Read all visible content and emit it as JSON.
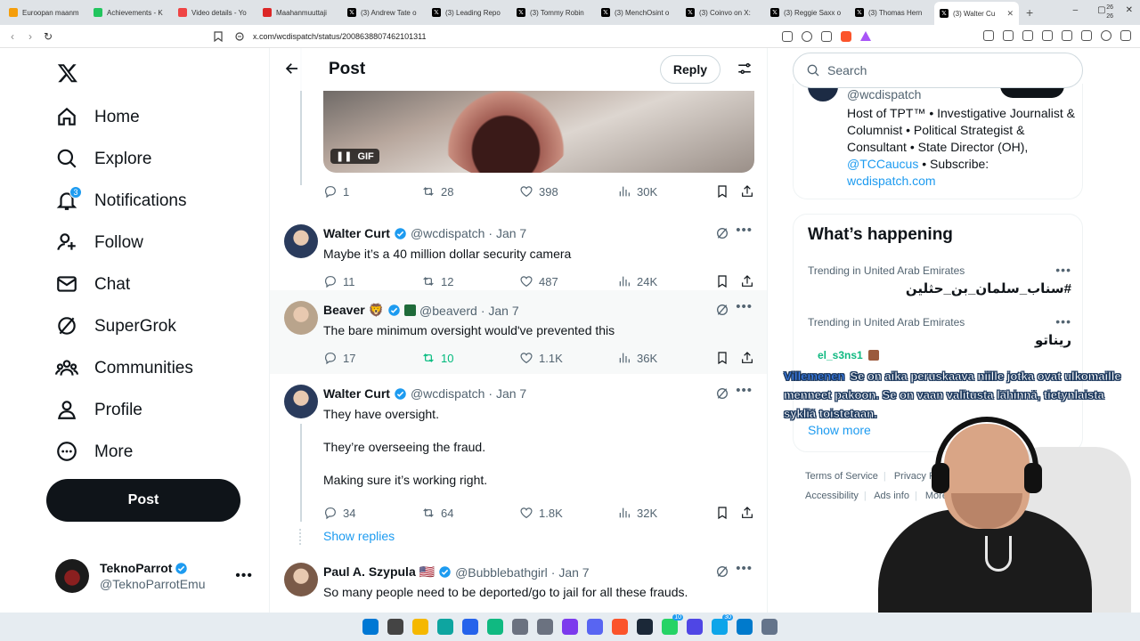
{
  "browser": {
    "tabs": [
      {
        "title": "Euroopan maanm",
        "color": "#f59e0b",
        "icon": "eu-icon"
      },
      {
        "title": "Achievements - K",
        "color": "#22c55e",
        "icon": "k-icon"
      },
      {
        "title": "Video details - Yo",
        "color": "#ef4444",
        "icon": "youtube-icon"
      },
      {
        "title": "Maahanmuuttaji",
        "color": "#dc2626",
        "icon": "news-icon"
      },
      {
        "title": "(3) Andrew Tate o",
        "color": "#000000",
        "icon": "x-icon"
      },
      {
        "title": "(3) Leading Repo",
        "color": "#000000",
        "icon": "x-icon"
      },
      {
        "title": "(3) Tommy Robin",
        "color": "#000000",
        "icon": "x-icon"
      },
      {
        "title": "(3) MenchOsint o",
        "color": "#000000",
        "icon": "x-icon"
      },
      {
        "title": "(3) Coinvo on X:",
        "color": "#000000",
        "icon": "x-icon"
      },
      {
        "title": "(3) Reggie Saxx o",
        "color": "#000000",
        "icon": "x-icon"
      },
      {
        "title": "(3) Thomas Hern",
        "color": "#000000",
        "icon": "x-icon"
      },
      {
        "title": "(3) Walter Cu",
        "color": "#000000",
        "icon": "x-icon",
        "active": true
      }
    ],
    "url": "x.com/wcdispatch/status/2008638807462101311"
  },
  "sidebar": {
    "nav": [
      {
        "label": "Home",
        "icon": "home-icon"
      },
      {
        "label": "Explore",
        "icon": "search-icon"
      },
      {
        "label": "Notifications",
        "icon": "bell-icon",
        "badge": "3"
      },
      {
        "label": "Follow",
        "icon": "add-person-icon"
      },
      {
        "label": "Chat",
        "icon": "mail-icon"
      },
      {
        "label": "SuperGrok",
        "icon": "grok-icon"
      },
      {
        "label": "Communities",
        "icon": "communities-icon"
      },
      {
        "label": "Profile",
        "icon": "person-icon"
      },
      {
        "label": "More",
        "icon": "more-circle-icon"
      }
    ],
    "post_label": "Post",
    "account": {
      "name": "TeknoParrot",
      "handle": "@TeknoParrotEmu"
    }
  },
  "main": {
    "header": {
      "title": "Post",
      "reply_label": "Reply"
    },
    "gif_label": "GIF",
    "first_actions": {
      "replies": "1",
      "reposts": "28",
      "likes": "398",
      "views": "30K"
    },
    "tweets": [
      {
        "name": "Walter Curt",
        "handle": "@wcdispatch",
        "date": "· Jan 7",
        "text": [
          "Maybe it’s a 40 million dollar security camera"
        ],
        "replies": "11",
        "reposts": "12",
        "likes": "487",
        "views": "24K"
      },
      {
        "name": "Beaver 🦁",
        "handle": "@beaverd",
        "date": "· Jan 7",
        "text": [
          "The bare minimum oversight would've prevented this"
        ],
        "replies": "17",
        "reposts": "10",
        "likes": "1.1K",
        "views": "36K"
      },
      {
        "name": "Walter Curt",
        "handle": "@wcdispatch",
        "date": "· Jan 7",
        "text": [
          "They have oversight.",
          "They’re overseeing the fraud.",
          "Making sure it’s working right."
        ],
        "replies": "34",
        "reposts": "64",
        "likes": "1.8K",
        "views": "32K"
      },
      {
        "name": "Paul A. Szypula 🇺🇸",
        "handle": "@Bubblebathgirl",
        "date": "· Jan 7",
        "text": [
          "So many people need to be deported/go to jail for all these frauds."
        ]
      }
    ],
    "show_replies": "Show replies"
  },
  "right": {
    "search_placeholder": "Search",
    "bio": {
      "handle": "@wcdispatch",
      "text": "Host of TPT™ • Investigative Journalist & Columnist • Political Strategist & Consultant • State Director (OH),",
      "link1": "@TCCaucus",
      "mid": "• Subscribe:",
      "link2": "wcdispatch.com"
    },
    "trends_title": "What’s happening",
    "trends": [
      {
        "meta": "Trending in United Arab Emirates",
        "name": "#سناب_سلمان_بن_حثلين"
      },
      {
        "meta": "Trending in United Arab Emirates",
        "name": "ريناتو"
      }
    ],
    "show_more": "Show more",
    "footer": [
      "Terms of Service",
      "Privacy Policy",
      "Accessibility",
      "Ads info",
      "More"
    ]
  },
  "overlay": {
    "chat_user": "el_s3ns1",
    "speaker": "Villemenen",
    "caption": "Se on aika peruskaava niille jotka ovat ulkomaille menneet pakoon. Se on vaan valitusta lähinnä, tietynlaista sykliä toistetaan."
  },
  "taskbar": {
    "icons": [
      {
        "name": "windows-start-icon",
        "color": "#0078d4"
      },
      {
        "name": "task-view-icon",
        "color": "#444444"
      },
      {
        "name": "file-explorer-icon",
        "color": "#f5b800"
      },
      {
        "name": "edge-icon",
        "color": "#0ea5a0"
      },
      {
        "name": "store-icon",
        "color": "#2563eb"
      },
      {
        "name": "app-icon",
        "color": "#10b981"
      },
      {
        "name": "calculator-icon",
        "color": "#6b7280"
      },
      {
        "name": "settings-icon",
        "color": "#6b7280"
      },
      {
        "name": "obs-icon",
        "color": "#7c3aed"
      },
      {
        "name": "discord-icon",
        "color": "#5865f2"
      },
      {
        "name": "brave-icon",
        "color": "#fb542b"
      },
      {
        "name": "steam-icon",
        "color": "#1b2838"
      },
      {
        "name": "whatsapp-icon",
        "color": "#25d366",
        "badge": "10"
      },
      {
        "name": "chat-app-icon",
        "color": "#4f46e5"
      },
      {
        "name": "messenger-icon",
        "color": "#0ea5e9",
        "badge": "30"
      },
      {
        "name": "vscode-icon",
        "color": "#007acc"
      },
      {
        "name": "notepad-icon",
        "color": "#64748b"
      }
    ],
    "clock": [
      "26",
      "26"
    ]
  }
}
